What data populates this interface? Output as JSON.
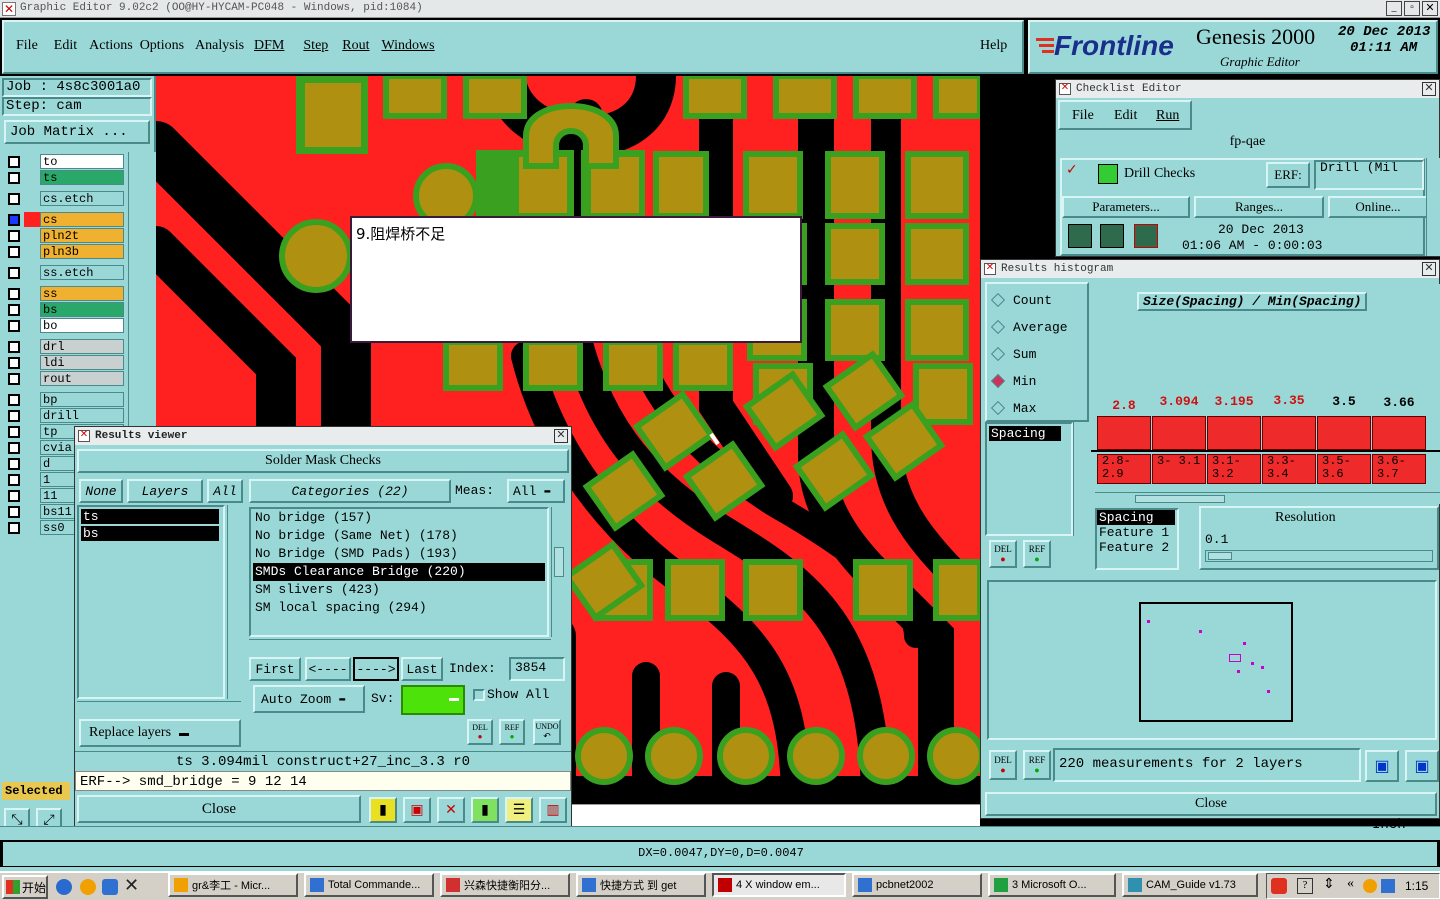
{
  "app": {
    "title": "Graphic Editor 9.02c2  (OO@HY-HYCAM-PC048 - Windows, pid:1084)",
    "brand": "Frontline",
    "product": "Genesis 2000",
    "subtitle": "Graphic Editor",
    "date": "20 Dec 2013",
    "time": "01:11 AM"
  },
  "menu": [
    "File",
    "Edit",
    "Actions",
    "Options",
    "Analysis",
    "DFM",
    "Step",
    "Rout",
    "Windows"
  ],
  "help_label": "Help",
  "job": {
    "job_line": "Job : 4s8c3001a0",
    "step_line": "Step: cam",
    "matrix_btn": "Job Matrix ..."
  },
  "layers": [
    {
      "name": "to",
      "color": "#ffffff"
    },
    {
      "name": "ts",
      "color": "#2aa86a"
    },
    {
      "name": "cs.etch",
      "color": "#9ad8d8"
    },
    {
      "name": "cs",
      "color": "#f0b030"
    },
    {
      "name": "pln2t",
      "color": "#f0b030"
    },
    {
      "name": "pln3b",
      "color": "#f0b030"
    },
    {
      "name": "ss.etch",
      "color": "#9ad8d8"
    },
    {
      "name": "ss",
      "color": "#f0b030"
    },
    {
      "name": "bs",
      "color": "#2aa86a"
    },
    {
      "name": "bo",
      "color": "#ffffff"
    },
    {
      "name": "drl",
      "color": "#c8d0d0"
    },
    {
      "name": "ldi",
      "color": "#c8d0d0"
    },
    {
      "name": "rout",
      "color": "#c8d0d0"
    },
    {
      "name": "bp",
      "color": "#9ad8d8"
    },
    {
      "name": "drill",
      "color": "#9ad8d8"
    },
    {
      "name": "tp",
      "color": "#9ad8d8"
    },
    {
      "name": "cvia",
      "color": "#9ad8d8"
    },
    {
      "name": "d",
      "color": "#9ad8d8"
    },
    {
      "name": "1",
      "color": "#9ad8d8"
    },
    {
      "name": "11",
      "color": "#9ad8d8"
    },
    {
      "name": "bs11",
      "color": "#9ad8d8"
    },
    {
      "name": "ss0",
      "color": "#9ad8d8"
    }
  ],
  "selected_label": "Selected",
  "annotation_text": "9.阻焊桥不足",
  "checklist": {
    "title": "Checklist Editor",
    "menu": [
      "File",
      "Edit",
      "Run"
    ],
    "name": "fp-qae",
    "check_name": "Drill Checks",
    "erf_label": "ERF:",
    "erf_value": "Drill (Mil",
    "parameters_btn": "Parameters...",
    "ranges_btn": "Ranges...",
    "online_btn": "Online...",
    "run_date": "20 Dec 2013",
    "run_time": "01:06 AM - 0:00:03"
  },
  "histogram": {
    "title": "Results histogram",
    "options": [
      "Count",
      "Average",
      "Sum",
      "Min",
      "Max"
    ],
    "selected_option": "Min",
    "chart_title": "Size(Spacing) / Min(Spacing)",
    "bar_values": [
      "2.8",
      "3.094",
      "3.195",
      "3.35",
      "3.5",
      "3.66"
    ],
    "bar_heights": [
      0.39,
      0.58,
      0.58,
      0.62,
      0.6,
      0.53
    ],
    "ranges": [
      "2.8- 2.9",
      "3- 3.1",
      "3.1- 3.2",
      "3.3- 3.4",
      "3.5- 3.6",
      "3.6- 3.7"
    ],
    "list_item": "Spacing",
    "features": [
      "Spacing",
      "Feature 1",
      "Feature 2"
    ],
    "resolution_label": "Resolution",
    "resolution_value": "0.1",
    "del_label": "DEL",
    "ref_label": "REF",
    "status": "220 measurements for 2 layers",
    "close": "Close"
  },
  "results_viewer": {
    "title": "Results viewer",
    "heading": "Solder Mask Checks",
    "none_btn": "None",
    "layers_btn": "Layers",
    "all_btn": "All",
    "layer_list": [
      "ts",
      "bs"
    ],
    "categories_btn": "Categories (22)",
    "meas_label": "Meas:",
    "meas_value": "All",
    "categories": [
      "No bridge (157)",
      "No bridge (Same Net) (178)",
      "No Bridge (SMD Pads) (193)",
      "SMDs Clearance Bridge (220)",
      "SM slivers (423)",
      "SM local spacing (294)"
    ],
    "selected_category": 3,
    "first_btn": "First",
    "prev_btn": "<----",
    "next_btn": "---->",
    "last_btn": "Last",
    "index_label": "Index:",
    "index_value": "3854",
    "auto_zoom": "Auto Zoom",
    "sv_label": "Sv:",
    "show_all": "Show All",
    "replace_layers": "Replace layers",
    "del_label": "DEL",
    "ref_label": "REF",
    "undo_label": "UNDO",
    "status_line": "ts 3.094mil  construct+27_inc_3.3  r0",
    "erf_line": "ERF--> smd_bridge = 9 12 14",
    "close": "Close"
  },
  "status_bar": "DX=0.0047,DY=0,D=0.0047",
  "partial_label": "Inch",
  "taskbar": {
    "start": "开始",
    "items": [
      "gr&李工 - Micr...",
      "Total Commande...",
      "兴森快捷衡阳分...",
      "快捷方式 到 get",
      "4 X window em...",
      "pcbnet2002",
      "3 Microsoft O...",
      "CAM_Guide v1.73"
    ],
    "clock": "1:15"
  }
}
